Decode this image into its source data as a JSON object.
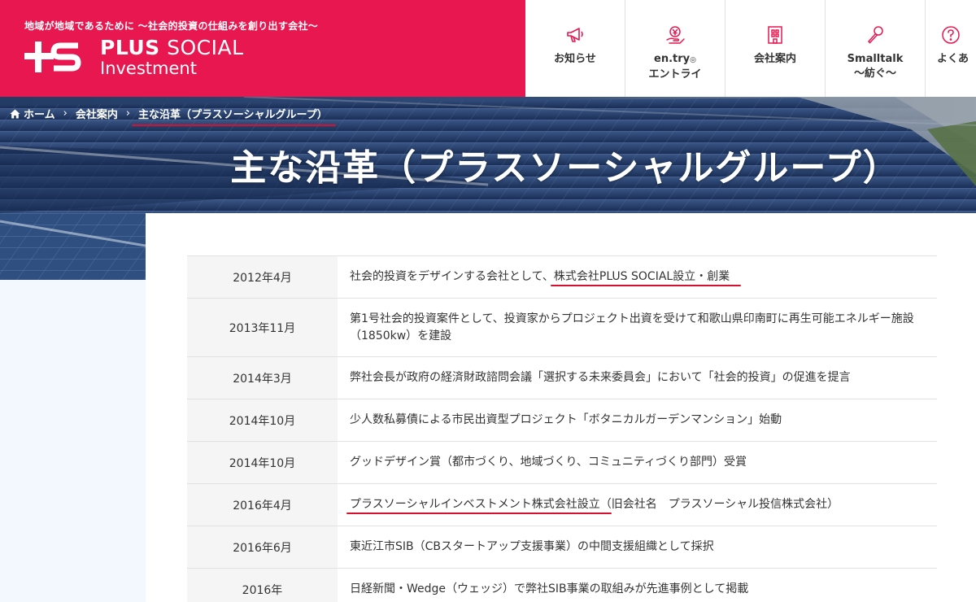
{
  "header": {
    "tagline": "地域が地域であるために ～社会的投資の仕組みを創り出す会社～",
    "logo_name_bold": "PLUS",
    "logo_name_rest": "SOCIAL",
    "logo_sub": "Investment",
    "brand_color": "#e8174f",
    "nav": [
      {
        "label": "お知らせ",
        "icon": "megaphone-icon"
      },
      {
        "label": "en.try",
        "label2": "エントライ",
        "icon": "yen-hand-icon"
      },
      {
        "label": "会社案内",
        "icon": "building-icon"
      },
      {
        "label": "Smalltalk",
        "label2": "～紡ぐ～",
        "icon": "microphone-icon"
      },
      {
        "label": "よくあ",
        "icon": "question-icon"
      }
    ]
  },
  "breadcrumb": {
    "home": "ホーム",
    "company": "会社案内",
    "current": "主な沿革（プラスソーシャルグループ）"
  },
  "page_title": "主な沿革（プラスソーシャルグループ）",
  "history": [
    {
      "date": "2012年4月",
      "pre": "社会的投資をデザインする会社として、",
      "hl": "株式会社PLUS SOCIAL設立・創業",
      "post": ""
    },
    {
      "date": "2013年11月",
      "pre": "第1号社会的投資案件として、投資家からプロジェクト出資を受けて和歌山県印南町に再生可能エネルギー施設（1850kw）を建設",
      "hl": "",
      "post": ""
    },
    {
      "date": "2014年3月",
      "pre": "弊社会長が政府の経済財政諮問会議「選択する未来委員会」において「社会的投資」の促進を提言",
      "hl": "",
      "post": ""
    },
    {
      "date": "2014年10月",
      "pre": "少人数私募債による市民出資型プロジェクト「ボタニカルガーデンマンション」始動",
      "hl": "",
      "post": ""
    },
    {
      "date": "2014年10月",
      "pre": "グッドデザイン賞（都市づくり、地域づくり、コミュニティづくり部門）受賞",
      "hl": "",
      "post": ""
    },
    {
      "date": "2016年4月",
      "pre": "",
      "hl": "プラスソーシャルインベストメント株式会社設立",
      "post": "（旧会社名　プラスソーシャル投信株式会社）"
    },
    {
      "date": "2016年6月",
      "pre": "東近江市SIB（CBスタートアップ支援事業）の中間支援組織として採択",
      "hl": "",
      "post": ""
    },
    {
      "date": "2016年",
      "pre": "日経新聞・Wedge（ウェッジ）で弊社SIB事業の取組みが先進事例として掲載",
      "hl": "",
      "post": ""
    }
  ]
}
